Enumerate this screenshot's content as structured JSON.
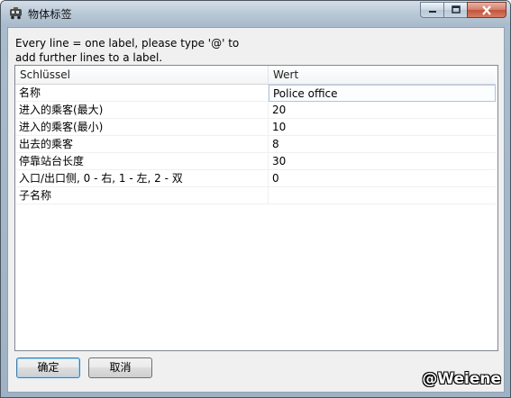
{
  "window": {
    "title": "物体标签",
    "icon": "train-icon"
  },
  "hint_text": "Every line = one label, please type '@' to\nadd further lines to a label.",
  "table": {
    "columns": [
      "Schlüssel",
      "Wert"
    ],
    "rows": [
      {
        "key": "名称",
        "value": "Police office",
        "editing": true
      },
      {
        "key": "进入的乘客(最大)",
        "value": "20"
      },
      {
        "key": "进入的乘客(最小)",
        "value": "10"
      },
      {
        "key": "出去的乘客",
        "value": "8"
      },
      {
        "key": "停靠站台长度",
        "value": "30"
      },
      {
        "key": "入口/出口侧, 0 - 右, 1 - 左, 2 - 双",
        "value": "0"
      },
      {
        "key": "子名称",
        "value": ""
      }
    ]
  },
  "buttons": {
    "ok": "确定",
    "cancel": "取消"
  },
  "watermark": "@Weiene",
  "colors": {
    "accent_border": "#3c7fb1",
    "edit_cell_border": "#a9c6e8",
    "close_button": "#c0533b"
  }
}
